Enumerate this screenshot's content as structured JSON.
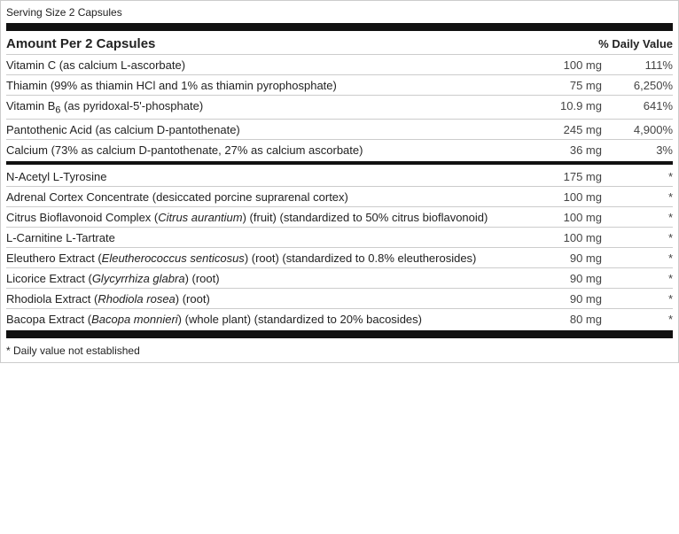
{
  "label": {
    "serving_size": "Serving Size 2 Capsules",
    "amount_per_label": "Amount Per 2 Capsules",
    "daily_value_label": "% Daily Value",
    "nutrients": [
      {
        "name": "Vitamin C (as calcium L-ascorbate)",
        "name_html": "Vitamin C (as calcium L-ascorbate)",
        "amount": "100 mg",
        "dv": "111%"
      },
      {
        "name": "Thiamin (99% as thiamin HCl and 1% as thiamin pyrophosphate)",
        "name_html": "Thiamin (99% as thiamin HCl and 1% as thiamin pyrophosphate)",
        "amount": "75 mg",
        "dv": "6,250%"
      },
      {
        "name": "Vitamin B6 (as pyridoxal-5'-phosphate)",
        "name_html": "Vitamin B<sub>6</sub> (as pyridoxal-5'-phosphate)",
        "amount": "10.9 mg",
        "dv": "641%"
      },
      {
        "name": "Pantothenic Acid (as calcium D-pantothenate)",
        "name_html": "Pantothenic Acid (as calcium D-pantothenate)",
        "amount": "245 mg",
        "dv": "4,900%"
      },
      {
        "name": "Calcium (73% as calcium D-pantothenate, 27% as calcium ascorbate)",
        "name_html": "Calcium (73% as calcium D-pantothenate, 27% as calcium ascorbate)",
        "amount": "36 mg",
        "dv": "3%"
      }
    ],
    "nutrients2": [
      {
        "name": "N-Acetyl L-Tyrosine",
        "name_html": "N-Acetyl L-Tyrosine",
        "amount": "175 mg",
        "dv": "*"
      },
      {
        "name": "Adrenal Cortex Concentrate (desiccated porcine suprarenal cortex)",
        "name_html": "Adrenal Cortex Concentrate (desiccated porcine suprarenal cortex)",
        "amount": "100 mg",
        "dv": "*"
      },
      {
        "name": "Citrus Bioflavonoid Complex (Citrus aurantium) (fruit) (standardized to 50% citrus bioflavonoid)",
        "name_html": "Citrus Bioflavonoid Complex (<em>Citrus aurantium</em>) (fruit) (standardized to 50% citrus bioflavonoid)",
        "amount": "100 mg",
        "dv": "*"
      },
      {
        "name": "L-Carnitine L-Tartrate",
        "name_html": "L-Carnitine L-Tartrate",
        "amount": "100 mg",
        "dv": "*"
      },
      {
        "name": "Eleuthero Extract (Eleutherococcus senticosus) (root) (standardized to 0.8% eleutherosides)",
        "name_html": "Eleuthero Extract (<em>Eleutherococcus senticosus</em>) (root) (standardized to 0.8% eleutherosides)",
        "amount": "90 mg",
        "dv": "*"
      },
      {
        "name": "Licorice Extract (Glycyrrhiza glabra) (root)",
        "name_html": "Licorice Extract (<em>Glycyrrhiza glabra</em>) (root)",
        "amount": "90 mg",
        "dv": "*"
      },
      {
        "name": "Rhodiola Extract (Rhodiola rosea) (root)",
        "name_html": "Rhodiola Extract (<em>Rhodiola rosea</em>) (root)",
        "amount": "90 mg",
        "dv": "*"
      },
      {
        "name": "Bacopa Extract (Bacopa monnieri) (whole plant) (standardized to 20% bacosides)",
        "name_html": "Bacopa Extract (<em>Bacopa monnieri</em>) (whole plant) (standardized to 20% bacosides)",
        "amount": "80 mg",
        "dv": "*"
      }
    ],
    "footnote": "* Daily value not established"
  }
}
